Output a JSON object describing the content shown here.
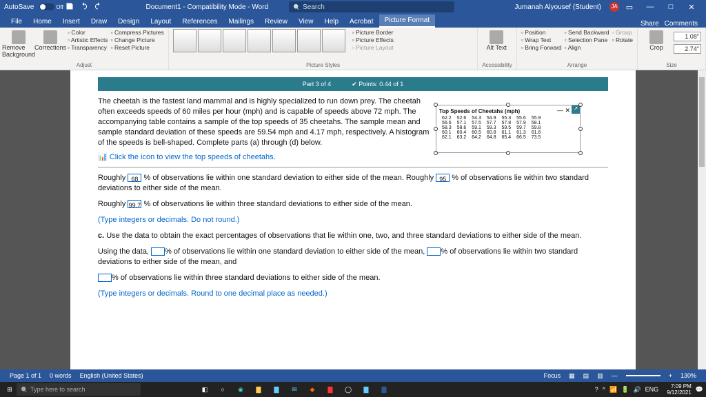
{
  "title": {
    "autosave": "AutoSave",
    "off": "Off",
    "doc": "Document1 - Compatibility Mode - Word",
    "search": "Search",
    "user": "Jumanah Alyousef (Student)",
    "initials": "JA"
  },
  "tabs": [
    "File",
    "Home",
    "Insert",
    "Draw",
    "Design",
    "Layout",
    "References",
    "Mailings",
    "Review",
    "View",
    "Help",
    "Acrobat",
    "Picture Format"
  ],
  "tabactive": "Picture Format",
  "share": "Share",
  "comments": "Comments",
  "ribbon": {
    "removebg": "Remove Background",
    "corrections": "Corrections",
    "adjust": [
      "Color",
      "Artistic Effects",
      "Transparency"
    ],
    "adjust2": [
      "Compress Pictures",
      "Change Picture",
      "Reset Picture"
    ],
    "adjustlabel": "Adjust",
    "styleslabel": "Picture Styles",
    "border": "Picture Border",
    "effects": "Picture Effects",
    "layout": "Picture Layout",
    "alt": "Alt Text",
    "acc": "Accessibility",
    "position": "Position",
    "wrap": "Wrap Text",
    "forward": "Bring Forward",
    "backward": "Send Backward",
    "selpane": "Selection Pane",
    "align": "Align",
    "group": "Group",
    "rotate": "Rotate",
    "arrangelabel": "Arrange",
    "crop": "Crop",
    "h": "1.08\"",
    "w": "2.74\"",
    "sizelabel": "Size"
  },
  "doc": {
    "banner1": "Part 3 of 4",
    "banner2": "Points: 0.44 of 1",
    "p1": "The cheetah is the fastest land mammal and is highly specialized to run down prey. The cheetah often exceeds speeds of 60 miles per hour (mph) and is capable of speeds above 72 mph. The accompanying table contains a sample of the top speeds of 35 cheetahs. The sample mean and sample standard deviation of these speeds are 59.54 mph and 4.17 mph, respectively. A histogram of the speeds is bell-shaped. Complete parts (a) through (d) below.",
    "icon_line": "Click the icon to view the top speeds of cheetahs.",
    "imgcap": "Top Speeds of Cheetahs (mph)",
    "rough_a": "Roughly ",
    "v68": "68",
    "pct_obs1": " % of observations lie within one standard deviation to either side of the mean. Roughly ",
    "v95": "95",
    "pct_obs2": " % of observations lie within two standard deviations to either side of the mean.",
    "rough_b": "Roughly ",
    "v997": "99.7",
    "pct_obs3": " % of observations lie within three standard deviations to either side of the mean.",
    "note1": "(Type integers or decimals. Do not round.)",
    "partc": "c. ",
    "partc_txt": "Use the data to obtain the exact percentages of observations that lie within one, two, and three standard deviations to either side of the mean.",
    "using": "Using the data, ",
    "blank": "",
    "pct1": "% of observations lie within one standard deviation to either side of the mean, ",
    "pct2": "% of observations lie within two standard deviations to either side of the mean, and",
    "pct3": "% of observations lie within three standard deviations to either side of the mean.",
    "note2": "(Type integers or decimals. Round to one decimal place as needed.)"
  },
  "chart_data": {
    "type": "table",
    "title": "Top Speeds of Cheetahs (mph)",
    "values": [
      [
        62.2,
        52.6,
        54.3,
        54.9,
        55.3,
        55.6,
        55.9
      ],
      [
        56.6,
        57.1,
        57.5,
        57.7,
        57.8,
        57.9,
        58.1
      ],
      [
        58.3,
        58.6,
        59.1,
        59.3,
        59.5,
        59.7,
        59.8
      ],
      [
        60.1,
        60.4,
        60.5,
        60.8,
        61.1,
        61.3,
        61.6
      ],
      [
        62.1,
        63.2,
        64.2,
        64.8,
        65.4,
        66.5,
        73.5
      ]
    ]
  },
  "status": {
    "page": "Page 1 of 1",
    "words": "0 words",
    "lang": "English (United States)",
    "focus": "Focus",
    "zoom": "130%"
  },
  "taskbar": {
    "search": "Type here to search",
    "time": "7:09 PM",
    "date": "9/12/2021",
    "lang": "ENG"
  }
}
